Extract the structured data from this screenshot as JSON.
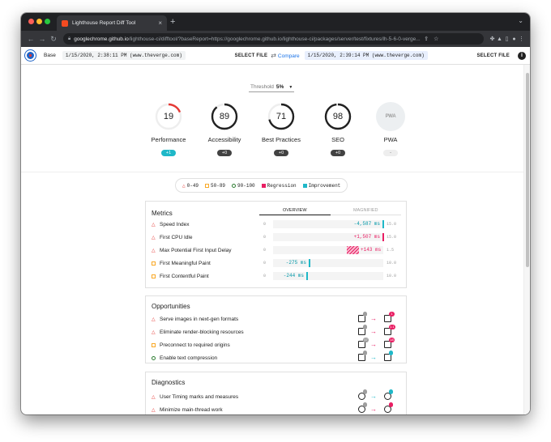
{
  "browser": {
    "tab_title": "Lighthouse Report Diff Tool",
    "tab_close": "×",
    "new_tab": "+",
    "url_host": "googlechrome.github.io",
    "url_path": "/lighthouse-ci/difftool/?baseReport=https://googlechrome.github.io/lighthouse-ci/packages/server/test/fixtures/lh-5-6-0-verge..."
  },
  "header": {
    "base_label": "Base",
    "base_run": "1/15/2020, 2:38:11 PM (www.theverge.com)",
    "select_file_left": "SELECT FILE",
    "compare_label": "Compare",
    "compare_run": "1/15/2020, 2:39:14 PM (www.theverge.com)",
    "select_file_right": "SELECT FILE",
    "info": "i"
  },
  "threshold": {
    "label": "Threshold",
    "value": "5%"
  },
  "gauges": [
    {
      "name": "Performance",
      "score": "19",
      "delta": "+1",
      "fraction": 0.19,
      "color": "#e53935",
      "delta_type": "up"
    },
    {
      "name": "Accessibility",
      "score": "89",
      "delta": "+0",
      "fraction": 0.89,
      "color": "#212121",
      "delta_type": "zero"
    },
    {
      "name": "Best Practices",
      "score": "71",
      "delta": "+0",
      "fraction": 0.71,
      "color": "#212121",
      "delta_type": "zero"
    },
    {
      "name": "SEO",
      "score": "98",
      "delta": "+0",
      "fraction": 0.98,
      "color": "#212121",
      "delta_type": "zero"
    },
    {
      "name": "PWA",
      "score": "PWA",
      "delta": "-",
      "fraction": 0,
      "color": "#9e9e9e",
      "delta_type": "na"
    }
  ],
  "legend": {
    "fail": "0-49",
    "average": "50-89",
    "pass": "90-100",
    "regression": "Regression",
    "improvement": "Improvement"
  },
  "metrics": {
    "title": "Metrics",
    "tab_overview": "OVERVIEW",
    "tab_magnified": "MAGNIFIED",
    "rows": [
      {
        "name": "Speed Index",
        "icon": "triangle",
        "min": "0",
        "delta": "-4,587 ms",
        "max": "15.0",
        "kind": "imp",
        "fraction": 0.99
      },
      {
        "name": "First CPU Idle",
        "icon": "triangle",
        "min": "0",
        "delta": "+1,507 ms",
        "max": "15.0",
        "kind": "reg",
        "fraction": 0.99
      },
      {
        "name": "Max Potential First Input Delay",
        "icon": "triangle",
        "min": "0",
        "delta": "+143 ms",
        "max": "1.5",
        "kind": "reg-range",
        "fraction": 0.78
      },
      {
        "name": "First Meaningful Paint",
        "icon": "square",
        "min": "0",
        "delta": "-275 ms",
        "max": "10.0",
        "kind": "imp",
        "fraction": 0.32
      },
      {
        "name": "First Contentful Paint",
        "icon": "square",
        "min": "0",
        "delta": "-244 ms",
        "max": "10.0",
        "kind": "imp",
        "fraction": 0.3
      }
    ]
  },
  "opportunities": {
    "title": "Opportunities",
    "rows": [
      {
        "name": "Serve images in next-gen formats",
        "icon": "triangle",
        "from_badge": "",
        "to_badge": "1",
        "direction": "reg"
      },
      {
        "name": "Eliminate render-blocking resources",
        "icon": "triangle",
        "from_badge": "",
        "to_badge": "1.1",
        "direction": "reg"
      },
      {
        "name": "Preconnect to required origins",
        "icon": "square",
        "from_badge": "17",
        "to_badge": "18",
        "direction": "reg"
      },
      {
        "name": "Enable text compression",
        "icon": "circle",
        "from_badge": "",
        "to_badge": "",
        "direction": "imp"
      }
    ]
  },
  "diagnostics": {
    "title": "Diagnostics",
    "rows": [
      {
        "name": "User Timing marks and measures",
        "icon": "triangle",
        "from_badge": "",
        "to_badge": "",
        "direction": "imp"
      },
      {
        "name": "Minimize main-thread work",
        "icon": "triangle",
        "from_badge": "",
        "to_badge": "",
        "direction": "reg"
      }
    ]
  }
}
